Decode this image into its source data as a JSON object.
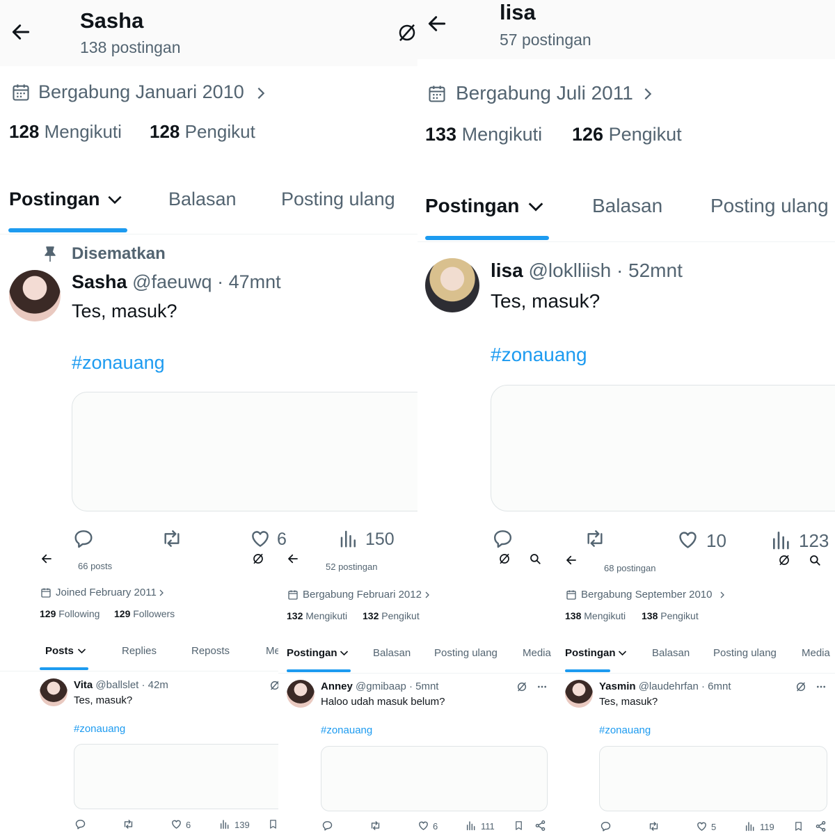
{
  "top_left": {
    "name": "Sasha",
    "posts": "138 postingan",
    "joined": "Bergabung Januari 2010",
    "following_count": "128",
    "following_label": "Mengikuti",
    "followers_count": "128",
    "followers_label": "Pengikut",
    "tabs": [
      "Postingan",
      "Balasan",
      "Posting ulang"
    ],
    "pinned_label": "Disematkan",
    "tweet": {
      "name": "Sasha",
      "handle": "@faeuwq",
      "time": "· 47mnt",
      "text": "Tes, masuk?",
      "hashtag": "#zonauang"
    },
    "stats": {
      "likes": "6",
      "views": "150"
    }
  },
  "top_right": {
    "name": "lisa",
    "posts": "57 postingan",
    "joined": "Bergabung Juli 2011",
    "following_count": "133",
    "following_label": "Mengikuti",
    "followers_count": "126",
    "followers_label": "Pengikut",
    "tabs": [
      "Postingan",
      "Balasan",
      "Posting ulang"
    ],
    "tweet": {
      "name": "lisa",
      "handle": "@loklliish",
      "time": "· 52mnt",
      "text": "Tes, masuk?",
      "hashtag": "#zonauang"
    },
    "stats": {
      "likes": "10",
      "views": "123"
    }
  },
  "bottom_1": {
    "posts": "66 posts",
    "joined": "Joined February 2011",
    "following_count": "129",
    "following_label": "Following",
    "followers_count": "129",
    "followers_label": "Followers",
    "tabs": [
      "Posts",
      "Replies",
      "Reposts",
      "Me"
    ],
    "tweet": {
      "name": "Vita",
      "handle": "@ballslet",
      "time": "· 42m",
      "text": "Tes, masuk?",
      "hashtag": "#zonauang"
    },
    "stats": {
      "likes": "6",
      "views": "139"
    }
  },
  "bottom_2": {
    "posts": "52 postingan",
    "joined": "Bergabung Februari 2012",
    "following_count": "132",
    "following_label": "Mengikuti",
    "followers_count": "132",
    "followers_label": "Pengikut",
    "tabs": [
      "Postingan",
      "Balasan",
      "Posting ulang",
      "Media"
    ],
    "tweet": {
      "name": "Anney",
      "handle": "@gmibaap",
      "time": "· 5mnt",
      "text": "Haloo udah masuk belum?",
      "hashtag": "#zonauang"
    },
    "stats": {
      "likes": "6",
      "views": "111"
    }
  },
  "bottom_3": {
    "posts": "68 postingan",
    "joined": "Bergabung September 2010",
    "following_count": "138",
    "following_label": "Mengikuti",
    "followers_count": "138",
    "followers_label": "Pengikut",
    "tabs": [
      "Postingan",
      "Balasan",
      "Posting ulang",
      "Media"
    ],
    "tweet": {
      "name": "Yasmin",
      "handle": "@laudehrfan",
      "time": "· 6mnt",
      "text": "Tes, masuk?",
      "hashtag": "#zonauang"
    },
    "stats": {
      "likes": "5",
      "views": "119"
    }
  },
  "colors": {
    "accent": "#1d9bf0",
    "text": "#0f1419",
    "muted": "#536471"
  },
  "icons": [
    "back-arrow-icon",
    "grok-icon",
    "search-icon",
    "calendar-icon",
    "chevron-right-icon",
    "chevron-down-icon",
    "pin-icon",
    "reply-icon",
    "repost-icon",
    "like-icon",
    "views-icon",
    "bookmark-icon",
    "share-icon",
    "more-icon"
  ]
}
